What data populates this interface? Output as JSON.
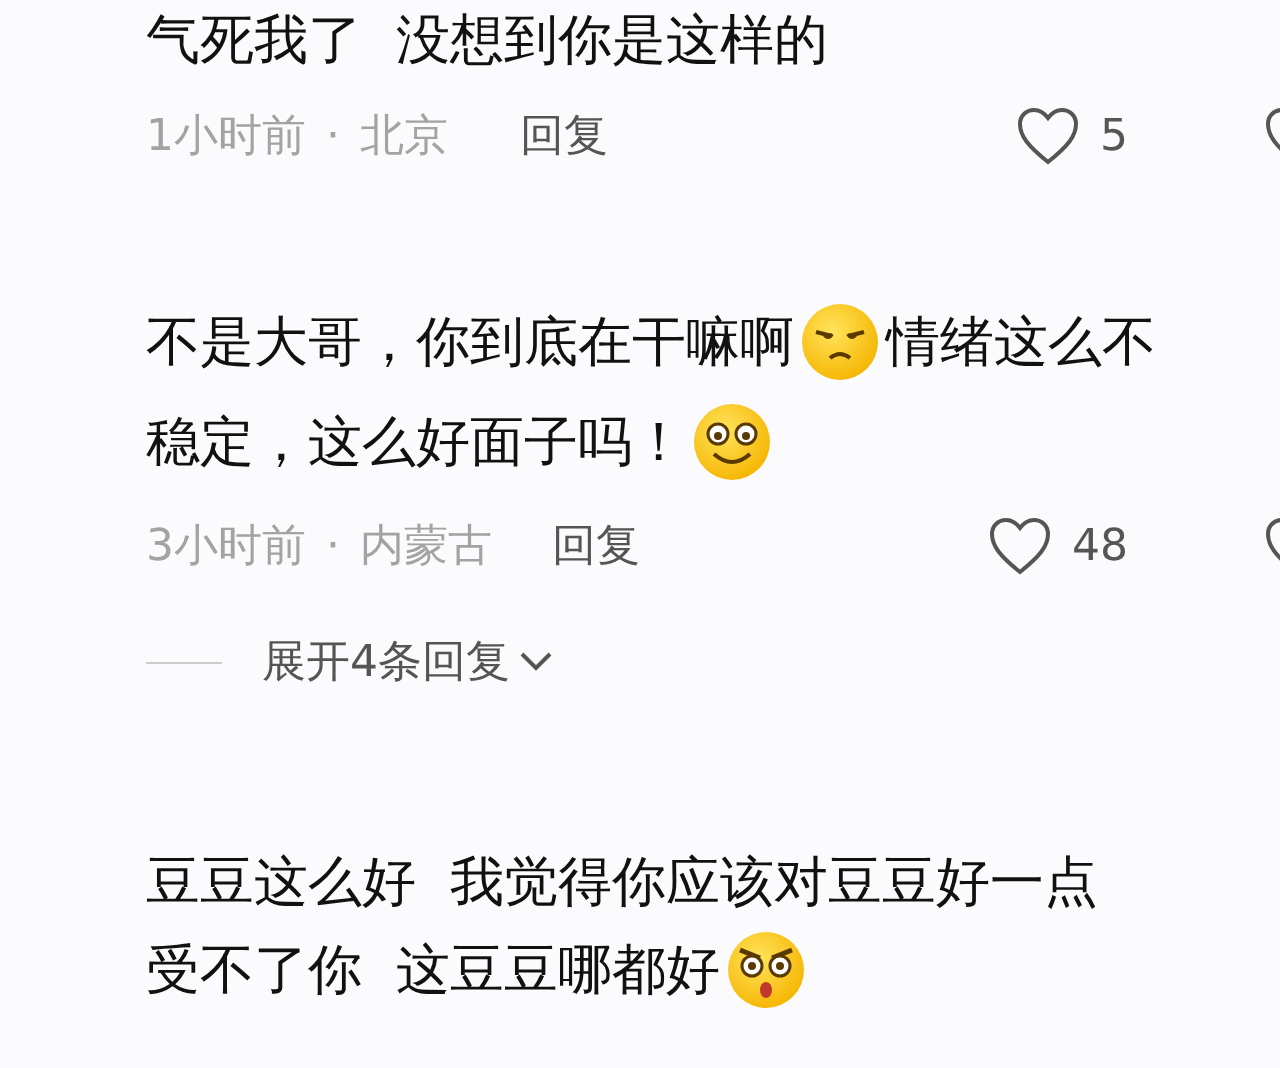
{
  "comments": [
    {
      "lines": [
        [
          {
            "kind": "text",
            "text": "气死我了  没想到你是这样的"
          }
        ]
      ],
      "time": "1小时前",
      "separator": "·",
      "location": "北京",
      "reply": "回复",
      "likes": "5"
    },
    {
      "lines": [
        [
          {
            "kind": "text",
            "text": "不是大哥，你到底在干嘛啊"
          },
          {
            "kind": "annoyed"
          },
          {
            "kind": "text",
            "text": "情绪这么不"
          }
        ],
        [
          {
            "kind": "text",
            "text": "稳定，这么好面子吗！"
          },
          {
            "kind": "smile"
          }
        ]
      ],
      "time": "3小时前",
      "separator": "·",
      "location": "内蒙古",
      "reply": "回复",
      "likes": "48",
      "expand": "展开4条回复"
    },
    {
      "lines": [
        [
          {
            "kind": "text",
            "text": "豆豆这么好  我觉得你应该对豆豆好一点"
          }
        ],
        [
          {
            "kind": "text",
            "text": "受不了你  这豆豆哪都好"
          },
          {
            "kind": "shocked"
          }
        ]
      ]
    }
  ]
}
